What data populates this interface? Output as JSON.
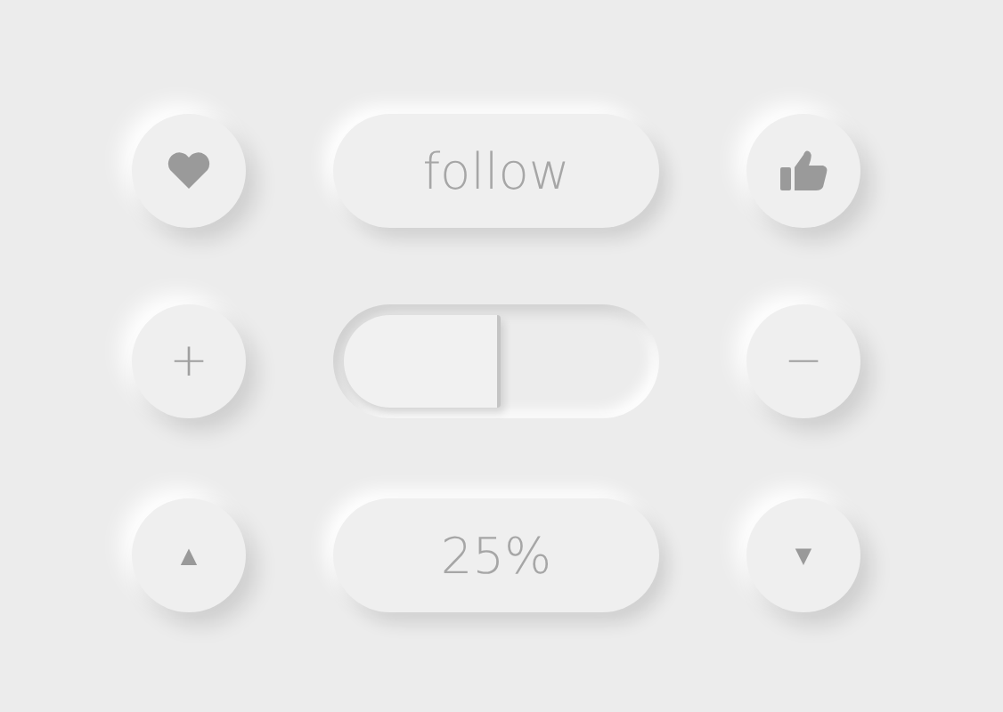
{
  "follow_button": {
    "label": "follow"
  },
  "plus_button": {
    "label": "+"
  },
  "toggle": {
    "on": false
  },
  "minus_button": {
    "label": "−"
  },
  "up_button": {
    "label": "▲"
  },
  "percent_display": {
    "value": "25%"
  },
  "down_button": {
    "label": "▼"
  }
}
